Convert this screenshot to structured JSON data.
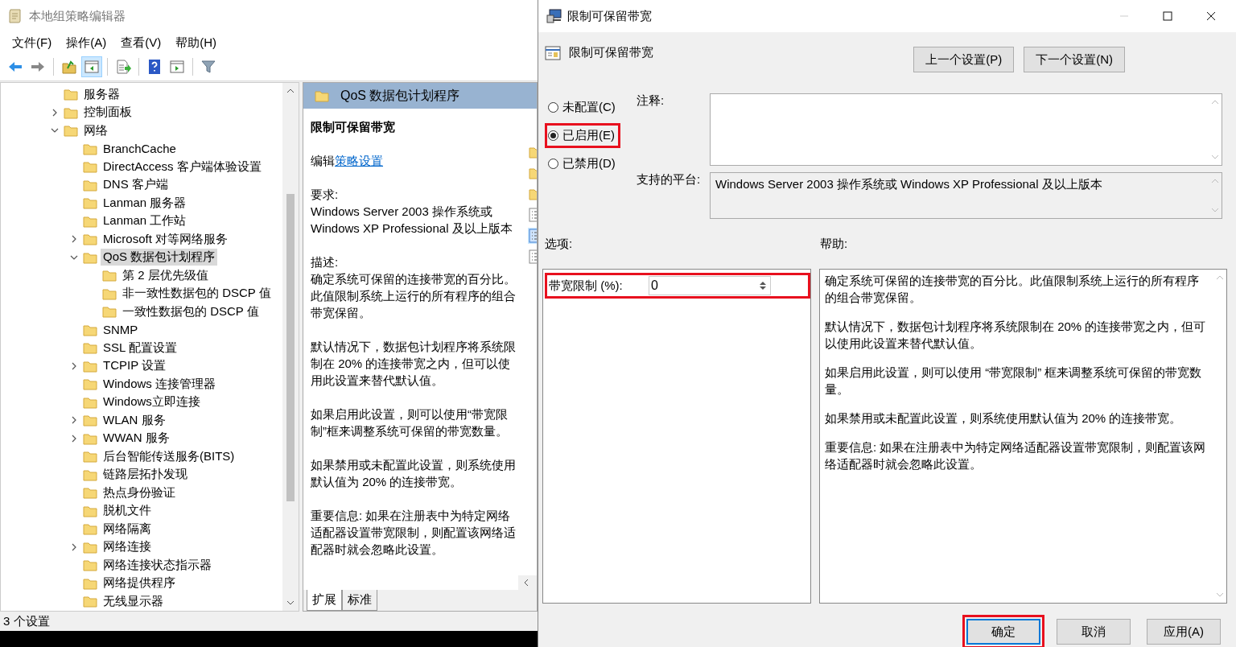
{
  "main_window": {
    "title": "本地组策略编辑器",
    "menu": [
      "文件(F)",
      "操作(A)",
      "查看(V)",
      "帮助(H)"
    ],
    "toolbar": [
      {
        "kind": "back",
        "disabled": false,
        "selected": false
      },
      {
        "kind": "forward",
        "disabled": true,
        "selected": false
      },
      {
        "kind": "separator"
      },
      {
        "kind": "up",
        "disabled": false,
        "selected": false
      },
      {
        "kind": "tree",
        "disabled": false,
        "selected": true
      },
      {
        "kind": "separator"
      },
      {
        "kind": "export",
        "disabled": false,
        "selected": false
      },
      {
        "kind": "separator"
      },
      {
        "kind": "help",
        "disabled": false,
        "selected": false
      },
      {
        "kind": "action",
        "disabled": false,
        "selected": false
      },
      {
        "kind": "separator"
      },
      {
        "kind": "filter",
        "disabled": false,
        "selected": false
      }
    ],
    "tree": [
      {
        "label": "服务器",
        "selected": false
      },
      {
        "label": "控制面板",
        "expanded": false,
        "selected": false
      },
      {
        "label": "网络",
        "expanded": true,
        "selected": false,
        "children": [
          {
            "label": "BranchCache",
            "selected": false
          },
          {
            "label": "DirectAccess 客户端体验设置",
            "selected": false
          },
          {
            "label": "DNS 客户端",
            "selected": false
          },
          {
            "label": "Lanman 服务器",
            "selected": false
          },
          {
            "label": "Lanman 工作站",
            "selected": false
          },
          {
            "label": "Microsoft 对等网络服务",
            "expanded": false,
            "selected": false
          },
          {
            "label": "QoS 数据包计划程序",
            "expanded": true,
            "selected": true,
            "children": [
              {
                "label": "第 2 层优先级值",
                "selected": false
              },
              {
                "label": "非一致性数据包的 DSCP 值",
                "selected": false
              },
              {
                "label": "一致性数据包的 DSCP 值",
                "selected": false
              }
            ]
          },
          {
            "label": "SNMP",
            "selected": false
          },
          {
            "label": "SSL 配置设置",
            "selected": false
          },
          {
            "label": "TCPIP 设置",
            "expanded": false,
            "selected": false
          },
          {
            "label": "Windows 连接管理器",
            "selected": false
          },
          {
            "label": "Windows立即连接",
            "selected": false
          },
          {
            "label": "WLAN 服务",
            "expanded": false,
            "selected": false
          },
          {
            "label": "WWAN 服务",
            "expanded": false,
            "selected": false
          },
          {
            "label": "后台智能传送服务(BITS)",
            "selected": false
          },
          {
            "label": "链路层拓扑发现",
            "selected": false
          },
          {
            "label": "热点身份验证",
            "selected": false
          },
          {
            "label": "脱机文件",
            "selected": false
          },
          {
            "label": "网络隔离",
            "selected": false
          },
          {
            "label": "网络连接",
            "expanded": false,
            "selected": false
          },
          {
            "label": "网络连接状态指示器",
            "selected": false
          },
          {
            "label": "网络提供程序",
            "selected": false
          },
          {
            "label": "无线显示器",
            "selected": false
          }
        ]
      }
    ],
    "detail": {
      "header": "QoS 数据包计划程序",
      "setting_title": "限制可保留带宽",
      "edit_prefix": "编辑",
      "edit_link": "策略设置",
      "paragraphs": [
        "要求:\nWindows Server 2003 操作系统或 Windows XP Professional 及以上版本",
        "描述:\n确定系统可保留的连接带宽的百分比。此值限制系统上运行的所有程序的组合带宽保留。",
        "默认情况下，数据包计划程序将系统限制在 20% 的连接带宽之内，但可以使用此设置来替代默认值。",
        "如果启用此设置，则可以使用“带宽限制”框来调整系统可保留的带宽数量。",
        "如果禁用或未配置此设置，则系统使用默认值为 20% 的连接带宽。",
        "重要信息: 如果在注册表中为特定网络适配器设置带宽限制，则配置该网络适配器时就会忽略此设置。"
      ],
      "list_items": [
        {
          "kind": "folder",
          "selected": false
        },
        {
          "kind": "folder",
          "selected": false
        },
        {
          "kind": "folder",
          "selected": false
        },
        {
          "kind": "setting",
          "selected": false
        },
        {
          "kind": "setting",
          "selected": true
        },
        {
          "kind": "setting",
          "selected": false
        }
      ],
      "tabs": [
        {
          "label": "扩展",
          "selected": true
        },
        {
          "label": "标准",
          "selected": false
        }
      ]
    },
    "status_bar": "3 个设置"
  },
  "dialog": {
    "title": "限制可保留带宽",
    "window_controls": [
      {
        "kind": "minimize",
        "disabled": true
      },
      {
        "kind": "maximize",
        "disabled": false
      },
      {
        "kind": "close",
        "disabled": false
      }
    ],
    "setting_name": "限制可保留带宽",
    "nav_buttons": [
      "上一个设置(P)",
      "下一个设置(N)"
    ],
    "radios": [
      {
        "label": "未配置(C)",
        "selected": false,
        "highlighted": false
      },
      {
        "label": "已启用(E)",
        "selected": true,
        "highlighted": true
      },
      {
        "label": "已禁用(D)",
        "selected": false,
        "highlighted": false
      }
    ],
    "comment_label": "注释:",
    "platform_label": "支持的平台:",
    "platform": "Windows Server 2003 操作系统或 Windows XP Professional 及以上版本",
    "options_label": "选项:",
    "help_label": "帮助:",
    "options": [
      {
        "label": "带宽限制 (%):",
        "value": "0",
        "highlighted": true
      }
    ],
    "help": [
      "确定系统可保留的连接带宽的百分比。此值限制系统上运行的所有程序的组合带宽保留。",
      "默认情况下，数据包计划程序将系统限制在 20% 的连接带宽之内，但可以使用此设置来替代默认值。",
      "如果启用此设置，则可以使用 “带宽限制” 框来调整系统可保留的带宽数量。",
      "如果禁用或未配置此设置，则系统使用默认值为 20% 的连接带宽。",
      "重要信息: 如果在注册表中为特定网络适配器设置带宽限制，则配置该网络适配器时就会忽略此设置。"
    ],
    "buttons": [
      {
        "label": "确定",
        "default": true,
        "highlighted": true
      },
      {
        "label": "取消",
        "default": false,
        "highlighted": false
      },
      {
        "label": "应用(A)",
        "default": false,
        "highlighted": false
      }
    ]
  }
}
